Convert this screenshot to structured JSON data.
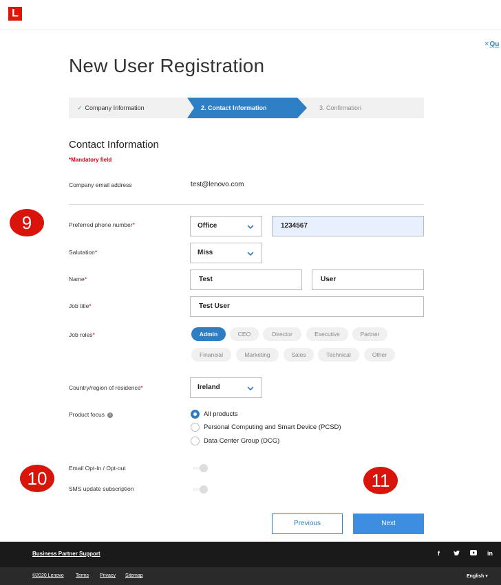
{
  "brand": {
    "logo_letter": "L",
    "color": "#e1140a",
    "accent": "#2d7ec5"
  },
  "header": {
    "quit_x": "×",
    "quit_label": "Qu"
  },
  "page": {
    "title": "New User Registration"
  },
  "stepper": {
    "step1": "Company Information",
    "step2": "2. Contact Information",
    "step3": "3. Confirmation"
  },
  "section": {
    "title": "Contact Information",
    "mandatory": "*Mandatory field"
  },
  "fields": {
    "company_email": {
      "label": "Company email address",
      "value": "test@lenovo.com"
    },
    "phone": {
      "label": "Preferred phone number",
      "type": "Office",
      "number": "1234567"
    },
    "salutation": {
      "label": "Salutation",
      "value": "Miss"
    },
    "name": {
      "label": "Name",
      "first": "Test",
      "last": "User"
    },
    "job_title": {
      "label": "Job title",
      "value": "Test User"
    },
    "job_roles": {
      "label": "Job roles",
      "options": [
        "Admin",
        "CEO",
        "Director",
        "Executive",
        "Partner",
        "Financial",
        "Marketing",
        "Sales",
        "Technical",
        "Other"
      ],
      "selected": "Admin"
    },
    "country": {
      "label": "Country/region of residence",
      "value": "Ireland"
    },
    "product_focus": {
      "label": "Product focus",
      "options": [
        "All products",
        "Personal Computing and Smart Device (PCSD)",
        "Data Center Group (DCG)"
      ],
      "selected": "All products"
    },
    "email_opt": {
      "label": "Email Opt-In / Opt-out",
      "on": false
    },
    "sms": {
      "label": "SMS update subscription",
      "on": false
    }
  },
  "markers": [
    "9",
    "10",
    "11"
  ],
  "buttons": {
    "previous": "Previous",
    "next": "Next"
  },
  "footer": {
    "support": "Business Partner Support",
    "social": [
      "f",
      "t",
      "yt",
      "in"
    ],
    "links": [
      "©2020 Lenovo",
      "Terms",
      "Privacy",
      "Sitemap"
    ],
    "language": "English"
  }
}
